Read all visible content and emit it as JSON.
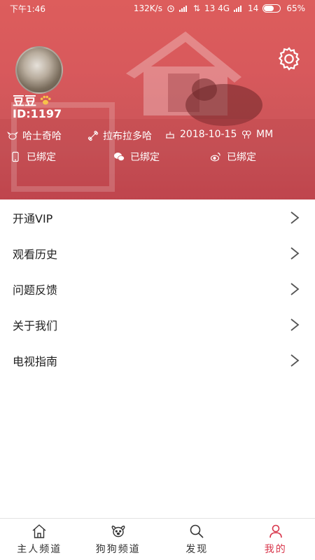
{
  "status_bar": {
    "time": "下午1:46",
    "network_speed": "132K/s",
    "signal_text": "13 4G",
    "signal_text_2": "14",
    "battery": "65%",
    "battery_level": 0.65
  },
  "profile": {
    "nickname": "豆豆",
    "id_text": "ID:1197",
    "info": {
      "breed": "哈士奇哈",
      "favorite": "拉布拉多哈",
      "birthday": "2018-10-15",
      "gender": "MM"
    },
    "bindings": {
      "phone": "已绑定",
      "wechat": "已绑定",
      "weibo": "已绑定"
    }
  },
  "menu": [
    {
      "label": "开通VIP"
    },
    {
      "label": "观看历史"
    },
    {
      "label": "问题反馈"
    },
    {
      "label": "关于我们"
    },
    {
      "label": "电视指南"
    }
  ],
  "tabs": [
    {
      "label": "主人频道",
      "icon": "home-icon"
    },
    {
      "label": "狗狗频道",
      "icon": "dog-face-icon"
    },
    {
      "label": "发现",
      "icon": "search-icon"
    },
    {
      "label": "我的",
      "icon": "person-icon"
    }
  ],
  "colors": {
    "header_red": "#d8595c",
    "active_tab": "#d8364b",
    "text": "#222222"
  }
}
